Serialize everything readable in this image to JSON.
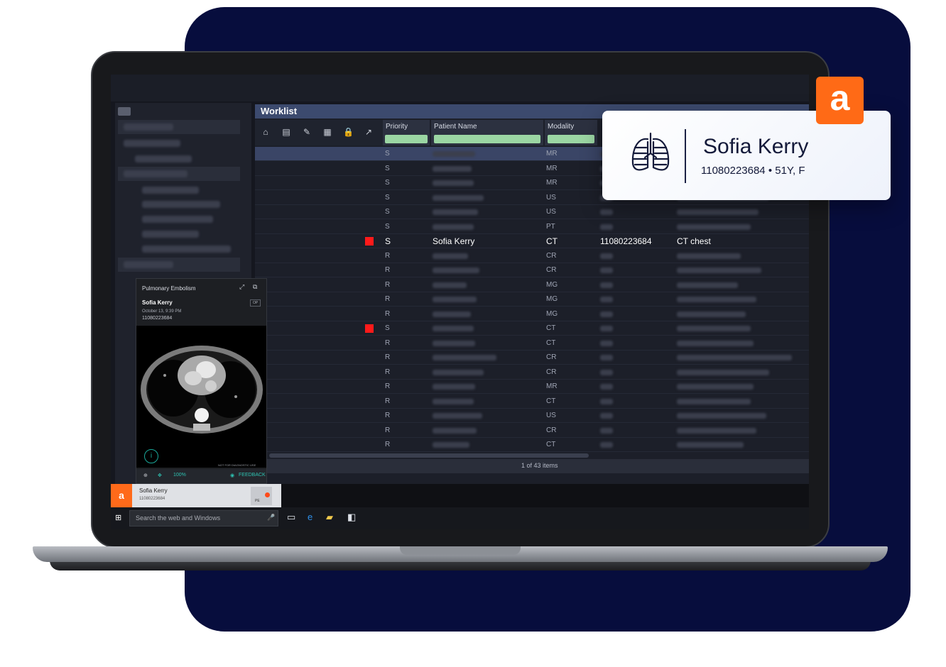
{
  "worklist": {
    "title": "Worklist",
    "columns": [
      "Priority",
      "Patient Name",
      "Modality"
    ],
    "rows": [
      {
        "priority": "S",
        "modality": "MR"
      },
      {
        "priority": "S",
        "modality": "MR"
      },
      {
        "priority": "S",
        "modality": "MR"
      },
      {
        "priority": "S",
        "modality": "US"
      },
      {
        "priority": "S",
        "modality": "US"
      },
      {
        "priority": "S",
        "modality": "PT"
      },
      {
        "priority": "S",
        "name": "Sofia Kerry",
        "modality": "CT",
        "id": "11080223684",
        "procedure": "CT chest"
      },
      {
        "priority": "R",
        "modality": "CR"
      },
      {
        "priority": "R",
        "modality": "CR"
      },
      {
        "priority": "R",
        "modality": "MG"
      },
      {
        "priority": "R",
        "modality": "MG"
      },
      {
        "priority": "R",
        "modality": "MG"
      },
      {
        "priority": "S",
        "modality": "CT"
      },
      {
        "priority": "R",
        "modality": "CT"
      },
      {
        "priority": "R",
        "modality": "CR"
      },
      {
        "priority": "R",
        "modality": "CR"
      },
      {
        "priority": "R",
        "modality": "MR"
      },
      {
        "priority": "R",
        "modality": "CT"
      },
      {
        "priority": "R",
        "modality": "US"
      },
      {
        "priority": "R",
        "modality": "CR"
      },
      {
        "priority": "R",
        "modality": "CT"
      }
    ],
    "footer": "1 of 43 items"
  },
  "pe_card": {
    "title": "Pulmonary Embolism",
    "name": "Sofia Kerry",
    "date": "October 13, 9:39 PM",
    "id": "11080223684",
    "badge": "OP",
    "not_diagnostic": "NOT FOR DIAGNOSTIC USE",
    "zoom": "100%",
    "feedback": "FEEDBACK",
    "info_symbol": "i"
  },
  "notification": {
    "logo": "a",
    "name": "Sofia Kerry",
    "id": "11080223684",
    "tag": "PE"
  },
  "taskbar": {
    "search_placeholder": "Search the web and Windows"
  },
  "patient_card": {
    "name": "Sofia Kerry",
    "details": "11080223684 • 51Y, F"
  },
  "brand_badge": "a",
  "colors": {
    "background_card": "#070d3d",
    "brand_orange": "#ff6a16",
    "priority_flag": "#ff1a1a",
    "filter_green": "#9bd6a3"
  }
}
